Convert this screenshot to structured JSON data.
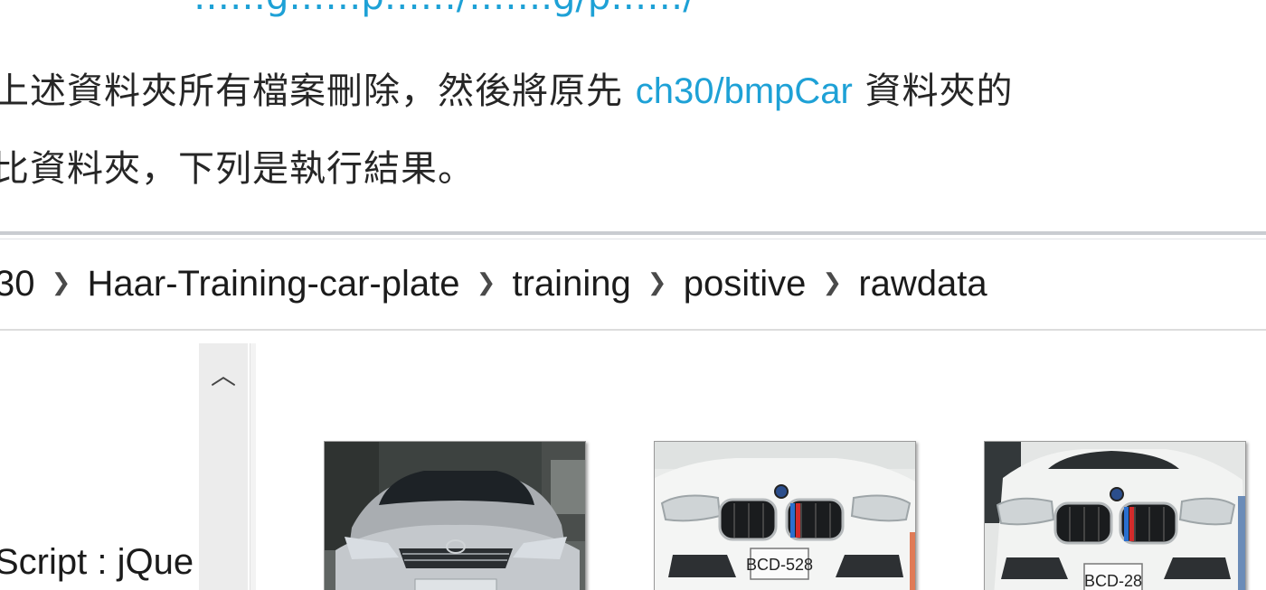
{
  "book": {
    "top_link_line": "……g……p……/…….g/p……/",
    "line1_before": "上述資料夾所有檔案刪除，然後將原先 ",
    "line1_link": "ch30/bmpCar",
    "line1_after": " 資料夾的",
    "line2": "比資料夾，下列是執行結果。"
  },
  "explorer": {
    "breadcrumb": [
      "30",
      "Haar-Training-car-plate",
      "training",
      "positive",
      "rawdata"
    ],
    "nav_pane_text": "Script : jQue",
    "thumbnails": [
      {
        "brand": "toyota",
        "plate": ""
      },
      {
        "brand": "bmw",
        "plate": "BCD-528"
      },
      {
        "brand": "bmw",
        "plate": "BCD-28"
      }
    ]
  },
  "colors": {
    "link": "#1ea1d6",
    "body_text": "#262626"
  }
}
